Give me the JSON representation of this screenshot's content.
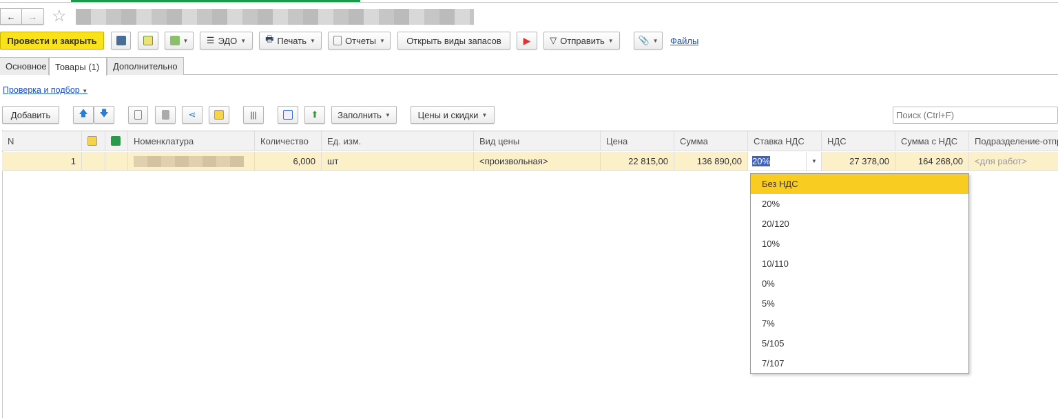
{
  "nav": {
    "back": "←",
    "forward": "→",
    "star": "☆"
  },
  "toolbar": {
    "post_close": "Провести и закрыть",
    "edo": "ЭДО",
    "print": "Печать",
    "reports": "Отчеты",
    "open_stock_types": "Открыть виды запасов",
    "send": "Отправить",
    "files": "Файлы"
  },
  "tabs": [
    "Основное",
    "Товары (1)",
    "Дополнительно"
  ],
  "check_link": "Проверка и подбор",
  "table_toolbar": {
    "add": "Добавить",
    "fill": "Заполнить",
    "prices": "Цены и скидки",
    "search_placeholder": "Поиск (Ctrl+F)"
  },
  "columns": [
    "N",
    "",
    "",
    "Номенклатура",
    "Количество",
    "Ед. изм.",
    "Вид цены",
    "Цена",
    "Сумма",
    "Ставка НДС",
    "НДС",
    "Сумма с НДС",
    "Подразделение-отпр"
  ],
  "row": {
    "n": "1",
    "qty": "6,000",
    "unit": "шт",
    "price_type": "<произвольная>",
    "price": "22 815,00",
    "sum": "136 890,00",
    "vat_rate": "20%",
    "vat": "27 378,00",
    "total": "164 268,00",
    "dept": "<для работ>"
  },
  "vat_options": [
    "Без НДС",
    "20%",
    "20/120",
    "10%",
    "10/110",
    "0%",
    "5%",
    "7%",
    "5/105",
    "7/107"
  ],
  "colors": {
    "accent": "#f9e21a",
    "row": "#fbf0c8",
    "highlight": "#f9cc22"
  }
}
